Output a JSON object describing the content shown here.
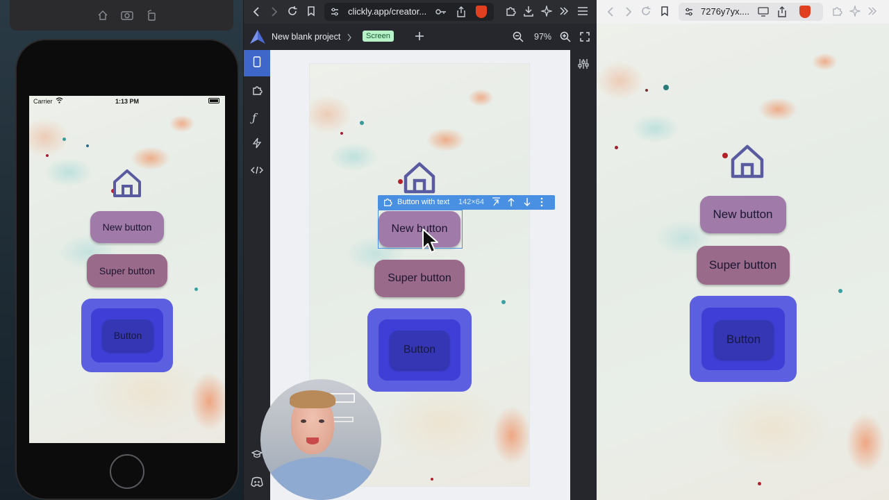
{
  "left_window": {
    "status": {
      "carrier": "Carrier",
      "time": "1:13 PM"
    },
    "buttons": {
      "new": "New button",
      "super": "Super button",
      "button": "Button"
    }
  },
  "middle_window": {
    "url": "clickly.app/creator...",
    "project_name": "New blank project",
    "breadcrumb_badge": "Screen",
    "zoom": "97%",
    "selection": {
      "label": "Button with text",
      "size": "142×64"
    },
    "buttons": {
      "new": "New button",
      "super": "Super button",
      "button": "Button"
    }
  },
  "right_window": {
    "url": "7276y7yx....",
    "buttons": {
      "new": "New button",
      "super": "Super button",
      "button": "Button"
    }
  },
  "colors": {
    "accent_blue": "#5b5fe0",
    "button_purple": "#a07aa8",
    "selection_blue": "#4a90e2",
    "badge_green": "#b8f0c8"
  }
}
